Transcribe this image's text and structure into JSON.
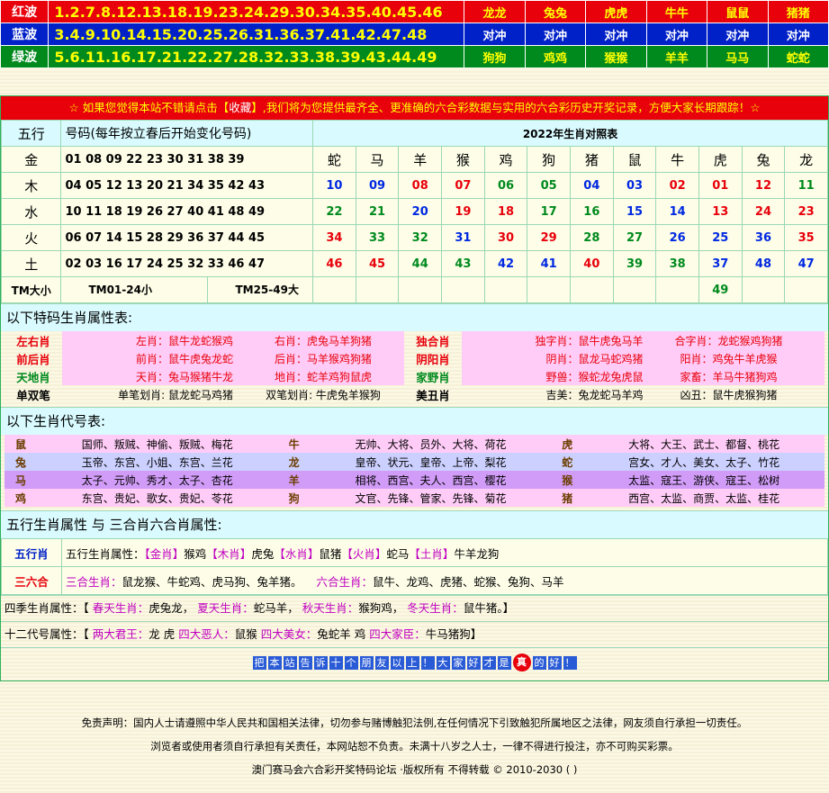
{
  "wave": [
    {
      "label": "红波",
      "nums": "1.2.7.8.12.13.18.19.23.24.29.30.34.35.40.45.46",
      "zodiacs": [
        "龙龙",
        "兔兔",
        "虎虎",
        "牛牛",
        "鼠鼠",
        "猪猪"
      ],
      "cls": "r-red"
    },
    {
      "label": "蓝波",
      "nums": "3.4.9.10.14.15.20.25.26.31.36.37.41.42.47.48",
      "zodiacs": [
        "对冲",
        "对冲",
        "对冲",
        "对冲",
        "对冲",
        "对冲"
      ],
      "cls": "r-blue"
    },
    {
      "label": "绿波",
      "nums": "5.6.11.16.17.21.22.27.28.32.33.38.39.43.44.49",
      "zodiacs": [
        "狗狗",
        "鸡鸡",
        "猴猴",
        "羊羊",
        "马马",
        "蛇蛇"
      ],
      "cls": "r-green"
    }
  ],
  "notice": {
    "pre": "☆  如果您觉得本站不错请点击【",
    "fav": "收藏",
    "post": "】,我们将为您提供最齐全、更准确的六合彩数据与实用的六合彩历史开奖记录，方便大家长期跟踪！☆"
  },
  "table_header": {
    "wuxing": "五行",
    "haoma": "号码(每年按立春后开始变化号码)",
    "year_title": "2022年生肖对照表"
  },
  "zodiac_cols": [
    "蛇",
    "马",
    "羊",
    "猴",
    "鸡",
    "狗",
    "猪",
    "鼠",
    "牛",
    "虎",
    "兔",
    "龙"
  ],
  "elements": [
    {
      "name": "金",
      "nums": "01 08 09 22 23 30 31 38 39",
      "cells": []
    },
    {
      "name": "木",
      "nums": "04 05 12 13 20 21 34 35 42 43",
      "cells": [
        {
          "v": "10",
          "c": "blue"
        },
        {
          "v": "09",
          "c": "blue"
        },
        {
          "v": "08",
          "c": "red"
        },
        {
          "v": "07",
          "c": "red"
        },
        {
          "v": "06",
          "c": "green"
        },
        {
          "v": "05",
          "c": "green"
        },
        {
          "v": "04",
          "c": "blue"
        },
        {
          "v": "03",
          "c": "blue"
        },
        {
          "v": "02",
          "c": "red"
        },
        {
          "v": "01",
          "c": "red"
        },
        {
          "v": "12",
          "c": "red"
        },
        {
          "v": "11",
          "c": "green"
        }
      ]
    },
    {
      "name": "水",
      "nums": "10 11 18 19 26 27 40 41 48 49",
      "cells": [
        {
          "v": "22",
          "c": "green"
        },
        {
          "v": "21",
          "c": "green"
        },
        {
          "v": "20",
          "c": "blue"
        },
        {
          "v": "19",
          "c": "red"
        },
        {
          "v": "18",
          "c": "red"
        },
        {
          "v": "17",
          "c": "green"
        },
        {
          "v": "16",
          "c": "green"
        },
        {
          "v": "15",
          "c": "blue"
        },
        {
          "v": "14",
          "c": "blue"
        },
        {
          "v": "13",
          "c": "red"
        },
        {
          "v": "24",
          "c": "red"
        },
        {
          "v": "23",
          "c": "red"
        }
      ]
    },
    {
      "name": "火",
      "nums": "06 07 14 15 28 29 36 37 44 45",
      "cells": [
        {
          "v": "34",
          "c": "red"
        },
        {
          "v": "33",
          "c": "green"
        },
        {
          "v": "32",
          "c": "green"
        },
        {
          "v": "31",
          "c": "blue"
        },
        {
          "v": "30",
          "c": "red"
        },
        {
          "v": "29",
          "c": "red"
        },
        {
          "v": "28",
          "c": "green"
        },
        {
          "v": "27",
          "c": "green"
        },
        {
          "v": "26",
          "c": "blue"
        },
        {
          "v": "25",
          "c": "blue"
        },
        {
          "v": "36",
          "c": "blue"
        },
        {
          "v": "35",
          "c": "red"
        }
      ]
    },
    {
      "name": "土",
      "nums": "02 03 16 17 24 25 32 33 46 47",
      "cells": [
        {
          "v": "46",
          "c": "red"
        },
        {
          "v": "45",
          "c": "red"
        },
        {
          "v": "44",
          "c": "green"
        },
        {
          "v": "43",
          "c": "green"
        },
        {
          "v": "42",
          "c": "blue"
        },
        {
          "v": "41",
          "c": "blue"
        },
        {
          "v": "40",
          "c": "red"
        },
        {
          "v": "39",
          "c": "green"
        },
        {
          "v": "38",
          "c": "green"
        },
        {
          "v": "37",
          "c": "blue"
        },
        {
          "v": "48",
          "c": "blue"
        },
        {
          "v": "47",
          "c": "blue"
        }
      ]
    }
  ],
  "tm_row": {
    "label": "TM大小",
    "small": "TM01-24小",
    "big": "TM25-49大",
    "extra": "49"
  },
  "sect_attr": "以下特码生肖属性表:",
  "attrs": [
    {
      "k1": "左右肖",
      "v1a": "左肖：鼠牛龙蛇猴鸡",
      "v1b": "右肖：虎兔马羊狗猪",
      "k2": "独合肖",
      "v2a": "独字肖：鼠牛虎兔马羊",
      "v2b": "合字肖：龙蛇猴鸡狗猪",
      "c1": "red",
      "c2": "red"
    },
    {
      "k1": "前后肖",
      "v1a": "前肖：鼠牛虎兔龙蛇",
      "v1b": "后肖：马羊猴鸡狗猪",
      "k2": "阴阳肖",
      "v2a": "阴肖：鼠龙马蛇鸡猪",
      "v2b": "阳肖：鸡兔牛羊虎猴",
      "c1": "red",
      "c2": "red"
    },
    {
      "k1": "天地肖",
      "v1a": "天肖：兔马猴猪牛龙",
      "v1b": "地肖：蛇羊鸡狗鼠虎",
      "k2": "家野肖",
      "v2a": "野兽：猴蛇龙兔虎鼠",
      "v2b": "家畜：羊马牛猪狗鸡",
      "c1": "green",
      "c2": "green"
    },
    {
      "k1": "单双笔",
      "v1a": "单笔划肖: 鼠龙蛇马鸡猪",
      "v1b": "双笔划肖: 牛虎兔羊猴狗",
      "k2": "美丑肖",
      "v2a": "吉美：兔龙蛇马羊鸡",
      "v2b": "凶丑：鼠牛虎猴狗猪",
      "c1": "",
      "c2": ""
    }
  ],
  "sect_nick": "以下生肖代号表:",
  "nicks": [
    {
      "a": "鼠",
      "av": "国师、叛贼、神偷、叛贼、梅花",
      "b": "牛",
      "bv": "无帅、大将、员外、大将、荷花",
      "c": "虎",
      "cv": "大将、大王、武士、都督、桃花",
      "bg": "pv"
    },
    {
      "a": "兔",
      "av": "玉帝、东宫、小姐、东宫、兰花",
      "b": "龙",
      "bv": "皇帝、状元、皇帝、上帝、梨花",
      "c": "蛇",
      "cv": "宫女、才人、美女、太子、竹花",
      "bg": "bv"
    },
    {
      "a": "马",
      "av": "太子、元帅、秀才、太子、杏花",
      "b": "羊",
      "bv": "相将、西宫、夫人、西宫、樱花",
      "c": "猴",
      "cv": "太监、寇王、游侠、寇王、松树",
      "bg": "mv"
    },
    {
      "a": "鸡",
      "av": "东宫、贵妃、歌女、贵妃、苓花",
      "b": "狗",
      "bv": "文官、先锋、管家、先锋、菊花",
      "c": "猪",
      "cv": "西宫、太监、商贾、太监、桂花",
      "bg": "pv"
    }
  ],
  "sect_wx": "五行生肖属性  与  三合肖六合肖属性:",
  "wx_row": {
    "k": "五行肖",
    "pre": "五行生肖属性：",
    "items": [
      {
        "t": "【金肖】",
        "v": "猴鸡"
      },
      {
        "t": "【木肖】",
        "v": "虎兔"
      },
      {
        "t": "【水肖】",
        "v": "鼠猪"
      },
      {
        "t": "【火肖】",
        "v": "蛇马"
      },
      {
        "t": "【土肖】",
        "v": "牛羊龙狗"
      }
    ]
  },
  "sh_row": {
    "k": "三六合",
    "sanhe_label": "三合生肖：",
    "sanhe": "鼠龙猴、牛蛇鸡、虎马狗、兔羊猪。",
    "liuhe_label": "六合生肖：",
    "liuhe": "鼠牛、龙鸡、虎猪、蛇猴、兔狗、马羊"
  },
  "season": {
    "label": "四季生肖属性：【",
    "items": [
      {
        "t": "春天生肖：",
        "v": "虎兔龙，"
      },
      {
        "t": "夏天生肖：",
        "v": "蛇马羊，"
      },
      {
        "t": "秋天生肖：",
        "v": "猴狗鸡，"
      },
      {
        "t": "冬天生肖：",
        "v": "鼠牛猪。"
      }
    ],
    "end": "】"
  },
  "twelve": {
    "label": "十二代号属性：【",
    "items": [
      {
        "t": "两大君王：",
        "v": "龙  虎"
      },
      {
        "t": "四大恶人：",
        "v": "鼠猴"
      },
      {
        "t": "四大美女：",
        "v": "兔蛇羊  鸡"
      },
      {
        "t": "四大家臣：",
        "v": "牛马猪狗"
      }
    ],
    "end": "】"
  },
  "slogan": [
    "把",
    "本",
    "站",
    "告",
    "诉",
    "十",
    "个",
    "朋",
    "友",
    "以",
    "上",
    "！",
    "大",
    "家",
    "好",
    "才",
    "是",
    "真",
    "的",
    "好",
    "！"
  ],
  "footer": {
    "line1": "免责声明：国内人士请遵照中华人民共和国相关法律，切勿参与赌博触犯法例,在任何情况下引致触犯所属地区之法律，网友须自行承担一切责任。",
    "line2": "浏览者或使用者须自行承担有关责任，本网站恕不负责。未满十八岁之人士，一律不得进行投注，亦不可购买彩票。",
    "line3": "澳门赛马会六合彩开奖特码论坛 ·版权所有 不得转载 © 2010-2030 ( )"
  }
}
